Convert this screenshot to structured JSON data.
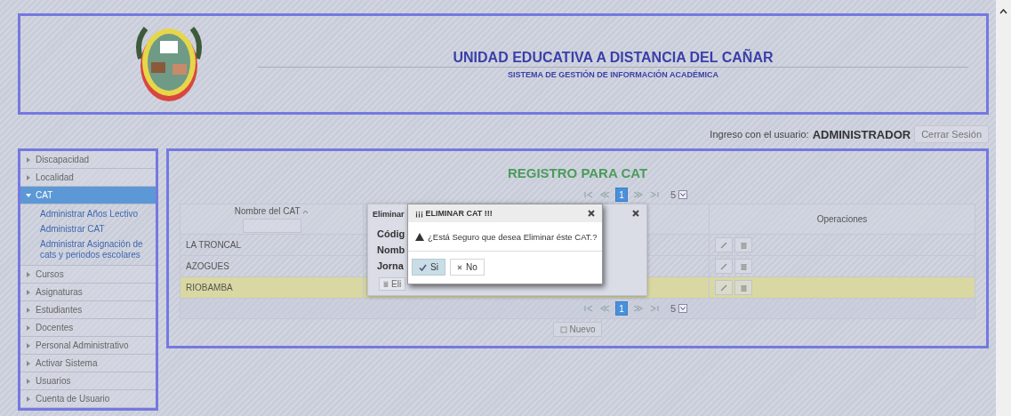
{
  "header": {
    "title": "UNIDAD EDUCATIVA A DISTANCIA DEL CAÑAR",
    "subtitle": "SISTEMA DE GESTIÓN DE INFORMACIÓN ACADÉMICA"
  },
  "user_bar": {
    "label": "Ingreso con el usuario:",
    "user": "ADMINISTRADOR",
    "logout": "Cerrar Sesión"
  },
  "sidebar": {
    "items": [
      {
        "label": "Discapacidad",
        "expanded": false
      },
      {
        "label": "Localidad",
        "expanded": false
      },
      {
        "label": "CAT",
        "expanded": true,
        "children": [
          {
            "label": "Administrar Años Lectivo"
          },
          {
            "label": "Administrar CAT"
          },
          {
            "label": "Administrar Asignación de cats y periodos escolares"
          }
        ]
      },
      {
        "label": "Cursos",
        "expanded": false
      },
      {
        "label": "Asignaturas",
        "expanded": false
      },
      {
        "label": "Estudiantes",
        "expanded": false
      },
      {
        "label": "Docentes",
        "expanded": false
      },
      {
        "label": "Personal Administrativo",
        "expanded": false
      },
      {
        "label": "Activar Sistema",
        "expanded": false
      },
      {
        "label": "Usuarios",
        "expanded": false
      },
      {
        "label": "Cuenta de Usuario",
        "expanded": false
      }
    ]
  },
  "panel": {
    "title": "REGISTRO PARA CAT",
    "paginators": [
      {
        "pages": [
          {
            "label": "1",
            "selected": true
          }
        ],
        "rows_per_page": "5"
      },
      {
        "pages": [
          {
            "label": "1",
            "selected": true
          }
        ],
        "rows_per_page": "5"
      }
    ],
    "table": {
      "columns": [
        "Nombre del CAT",
        "Operaciones"
      ],
      "rows": [
        {
          "name": "LA TRONCAL",
          "selected": false
        },
        {
          "name": "AZOGUES",
          "selected": false
        },
        {
          "name": "RIOBAMBA",
          "selected": true
        }
      ]
    },
    "new_button": "Nuevo"
  },
  "back_dialog": {
    "title": "Eliminar",
    "labels": [
      "Códig",
      "Nomb",
      "Jorna"
    ],
    "button": "Eli"
  },
  "confirm_dialog": {
    "title": "¡¡¡ ELIMINAR CAT !!!",
    "message": "¿Está Seguro que desea Eliminar éste CAT.?",
    "buttons": [
      {
        "label": "Si",
        "kind": "confirm"
      },
      {
        "label": "No",
        "kind": "cancel"
      }
    ]
  }
}
